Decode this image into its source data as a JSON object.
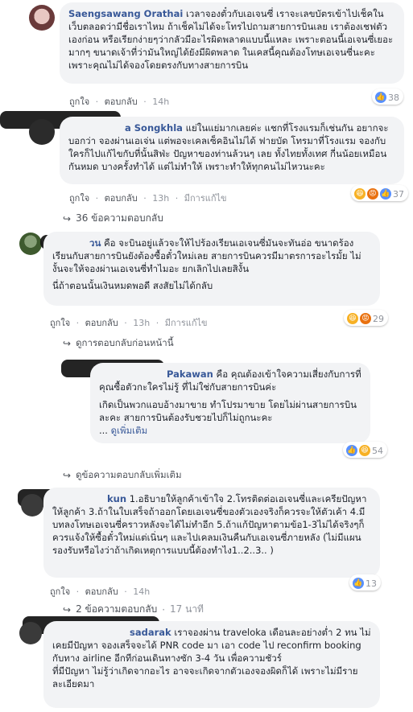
{
  "comments": [
    {
      "name": "Saengsawang Orathai",
      "text": "เวลาจองตั๋วกับเอเจนซี่ เราจะเลขบัตรเข้าไปเช็คในเว็บตลอดว่ามีชื่อเราไหม ถ้าเช็คไม่ได้จะโทรไปถามสายการบินเลย เราต้องเชฟตัวเองก่อน หรือเรียกง่ายๆว่ากลัวมีอะไรผิดพลาดแบบนี้แหละ เพราะตอนนี้เอเจนซี่เยอะมากๆ ขนาดเจ้าที่ว่ามันใหญ่ได้ยังมีผิดพลาด ในเคสนี้คุณต้องโทษเอเจนซี่นะคะ เพราะคุณไม่ได้จองโดยตรงกับทางสายการบิน",
      "like_label": "ถูกใจ",
      "reply_label": "ตอบกลับ",
      "time": "14h",
      "edited": "",
      "reactions": "38"
    },
    {
      "name": "a Songkhla",
      "text": "แย่ในแย่มากเลยค่ะ แชกที่โรงแรมก็เช่นกัน อยากจะบอกว่า จองผ่านเอเจ่น แต่พอจะเคลเซ็คอินไม่ได้ ฟายบัด โทรมาที่โรงแรม จองกับใครก็ไปแก้ไขกับที่นั้นสิฟ่ะ ปัญหาของท่านล้วนๆ เลย ทั้งไทยทั้งเทศ กี่นน้อยเหมือนกันหมด บางครั้งทำได้ แต่ไม่ทำให้ เพราะทำให้ทุกคนไม่ไหวนะคะ",
      "like_label": "ถูกใจ",
      "reply_label": "ตอบกลับ",
      "time": "13h",
      "edited": "มีการแก้ไข",
      "reactions": "37",
      "replies_label": "36 ข้อความตอบกลับ"
    },
    {
      "name": "วน",
      "text": "คือ จะบินอยู่แล้วจะให้ไปร้องเรียนเอเจนซี่มันจะทันอ่อ ขนาดร้องเรียนกับสายการบินยังต้องซื้อตั๋วใหม่เลย สายการบินควรมีมาตรการอะไรมั้ย ไม่งั้นจะให้จองผ่านเอเจนซี่ทำไมอะ ยกเลิกไปเลยสิงั้น",
      "text2": "นี่ถ้าตอนนั้นเงินหมดพอดี สงสัยไม่ได้กลับ",
      "like_label": "ถูกใจ",
      "reply_label": "ตอบกลับ",
      "time": "13h",
      "edited": "มีการแก้ไข",
      "reactions": "29",
      "prev_label": "ดูการตอบกลับก่อนหน้านี้"
    },
    {
      "name": "Pakawan",
      "text": "คือ คุณต้องเข้าใจความเสี่ยงกับการที่คุณซื้อตัวกะใครไม่รู้ ที่ไม่ใช่กับสายการบินค่ะ",
      "text2": "เกิดเป็นพวกแอบอ้างมาขาย ทำโปรมาขาย โดยไม่ผ่านสายการบินละคะ สายการบินต้องรับชวยไปก็ไม่ถูกนะคะ",
      "ellipsis": "...",
      "see_more": "ดูเพิ่มเติม",
      "reactions": "54",
      "more_replies_label": "ดูข้อความตอบกลับเพิ่มเติม"
    },
    {
      "name": "kun",
      "text": "1.อธิบายให้ลูกค้าเข้าใจ 2.โทรติดต่อเอเจนซี่และเครียปัญหาให้ลูกค้า 3.ถ้าในใบเสร็จถ้าออกโดยเอเจนซี่ของตัวเองจริงก็ควรจะให้ตัวเค้า 4.มีบทลงโทษเอเจนซี่คราวหลังจะได้ไม่ทำอีก 5.ถ้าแก้ปัญหาตามข้อ1-3ไม่ได้จริงๆก็ควรแจ้งให้ซื้อตั๋วใหม่แต่เนิ่นๆ และไปเคลมเงินคืนกับเอเจนซี่ภายหลัง (ไม่มีแผนรองรับหรือไงว่าถ้าเกิดเหตุการแบบนี้ต้องทำไง1..2..3.. )",
      "like_label": "ถูกใจ",
      "reply_label": "ตอบกลับ",
      "time": "14h",
      "edited": "",
      "reactions": "13",
      "replies_label": "2 ข้อความตอบกลับ",
      "replies_time": "17 นาที"
    },
    {
      "name": "sadarak",
      "text": "เราจองผ่าน traveloka เดือนละอย่างต่ำ 2 ทน ไม่เคยมีปัญหา จองเสร็จจะได้ PNR code มา เอา code ไป reconfirm booking กับทาง airline อีกทีก่อนเดินทางซัก 3-4 วัน เพื่อความชัวร์",
      "text2": "ที่มีปัญหา ไม่รู้ว่าเกิดจากอะไร อาจจะเกิดจากตัวเองจองผิดก็ได้ เพราะไม่มีรายละเอียดมา"
    }
  ],
  "separator": "·"
}
